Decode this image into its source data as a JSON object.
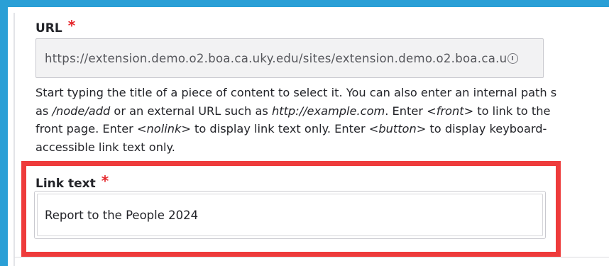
{
  "url_field": {
    "label": "URL",
    "required_marker": "*",
    "value": "https://extension.demo.o2.boa.ca.uky.edu/sites/extension.demo.o2.boa.ca.u",
    "trailing_icon": "autocomplete-icon"
  },
  "help_text": {
    "line1": "Start typing the title of a piece of content to select it. You can also enter an internal path s",
    "line2_pre": "as ",
    "line2_em1": "/node/add",
    "line2_mid1": " or an external URL such as ",
    "line2_em2": "http://example.com",
    "line2_mid2": ". Enter ",
    "line2_em3": "<front>",
    "line2_post": " to link to the",
    "line3_pre": "front page. Enter ",
    "line3_em1": "<nolink>",
    "line3_mid": " to display link text only. Enter ",
    "line3_em2": "<button>",
    "line3_post": " to display keyboard-",
    "line4": "accessible link text only."
  },
  "link_text_field": {
    "label": "Link text",
    "required_marker": "*",
    "value": "Report to the People 2024"
  },
  "colors": {
    "frame_accent": "#2a9fd6",
    "highlight": "#ee3b3b",
    "required": "#e5262b"
  }
}
